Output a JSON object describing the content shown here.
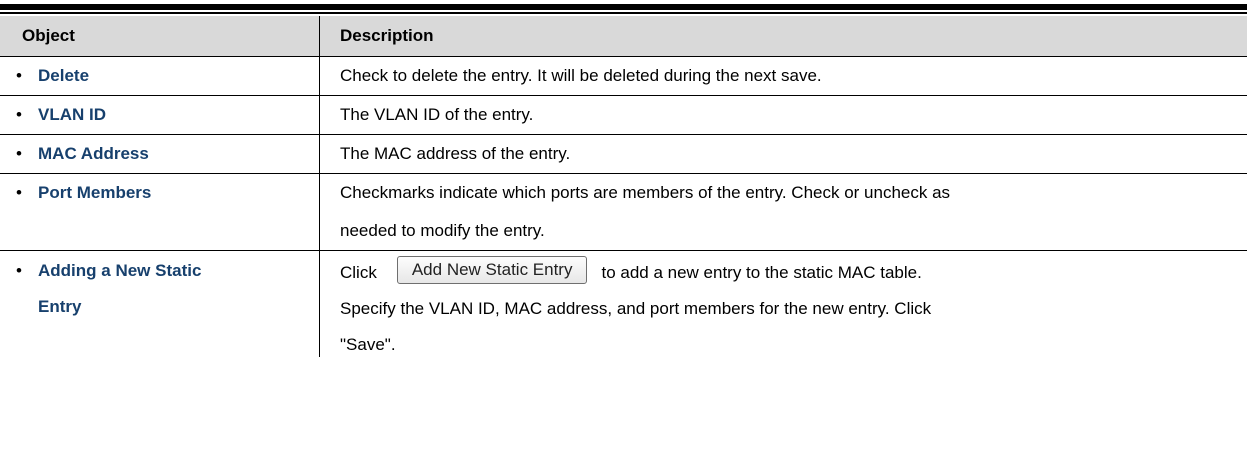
{
  "table": {
    "header": {
      "object": "Object",
      "description": "Description"
    },
    "rows": [
      {
        "object": "Delete",
        "description": "Check to delete the entry. It will be deleted during the next save."
      },
      {
        "object": "VLAN ID",
        "description": "The VLAN ID of the entry."
      },
      {
        "object": "MAC Address",
        "description": "The MAC address of the entry."
      },
      {
        "object": "Port Members",
        "description_line1": "Checkmarks indicate which ports are members of the entry. Check or uncheck as",
        "description_line2": "needed to modify the entry."
      },
      {
        "object_line1": "Adding a New Static",
        "object_line2": "Entry",
        "desc_click": "Click",
        "button_label": "Add New Static Entry",
        "desc_after_button": "to add a new entry to the static MAC table.",
        "desc_line2": "Specify the VLAN ID, MAC address, and port members for the new entry. Click",
        "desc_line3": "\"Save\"."
      }
    ]
  }
}
